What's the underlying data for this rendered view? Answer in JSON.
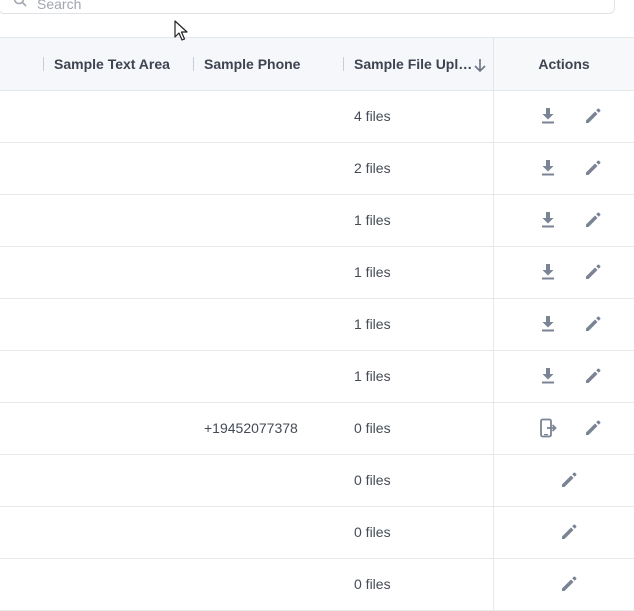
{
  "search": {
    "placeholder": "Search"
  },
  "table": {
    "columns": {
      "text_area": "Sample Text Area",
      "phone": "Sample Phone",
      "file_upload": "Sample File Upl…",
      "actions": "Actions"
    },
    "rows": [
      {
        "phone": "",
        "files": "4 files",
        "actions": [
          "download-icon",
          "edit-icon"
        ]
      },
      {
        "phone": "",
        "files": "2 files",
        "actions": [
          "download-icon",
          "edit-icon"
        ]
      },
      {
        "phone": "",
        "files": "1 files",
        "actions": [
          "download-icon",
          "edit-icon"
        ]
      },
      {
        "phone": "",
        "files": "1 files",
        "actions": [
          "download-icon",
          "edit-icon"
        ]
      },
      {
        "phone": "",
        "files": "1 files",
        "actions": [
          "download-icon",
          "edit-icon"
        ]
      },
      {
        "phone": "",
        "files": "1 files",
        "actions": [
          "download-icon",
          "edit-icon"
        ]
      },
      {
        "phone": "+19452077378",
        "files": "0 files",
        "actions": [
          "phone-transfer-icon",
          "edit-icon"
        ]
      },
      {
        "phone": "",
        "files": "0 files",
        "actions": [
          "edit-icon"
        ]
      },
      {
        "phone": "",
        "files": "0 files",
        "actions": [
          "edit-icon"
        ]
      },
      {
        "phone": "",
        "files": "0 files",
        "actions": [
          "edit-icon"
        ]
      }
    ]
  },
  "colors": {
    "icon": "#7b8494",
    "header_bg": "#f5f7fa",
    "border": "#e3e6ea"
  }
}
